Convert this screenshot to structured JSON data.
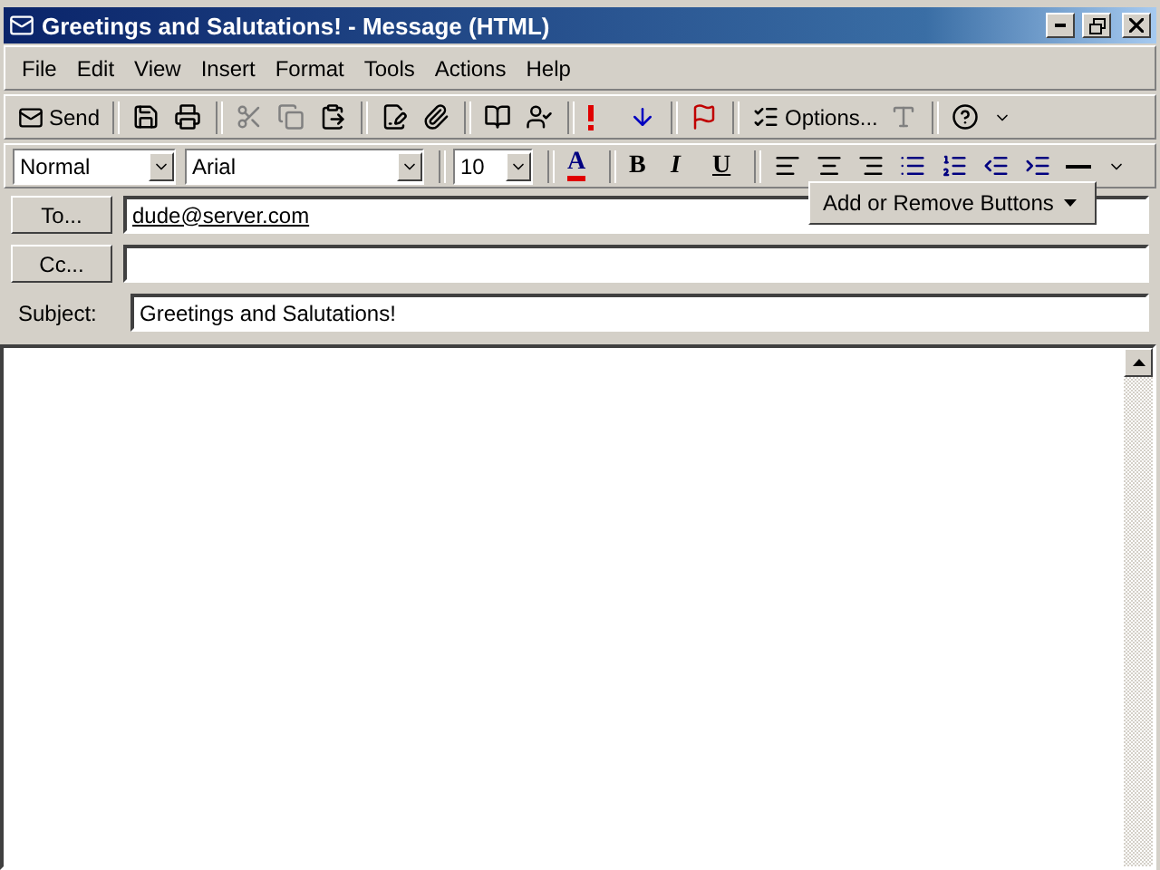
{
  "window": {
    "title": "Greetings and Salutations! - Message (HTML)"
  },
  "menu": [
    "File",
    "Edit",
    "View",
    "Insert",
    "Format",
    "Tools",
    "Actions",
    "Help"
  ],
  "standard_toolbar": [
    {
      "kind": "send",
      "label": "Send",
      "disabled": false
    },
    {
      "kind": "separator"
    },
    {
      "kind": "save",
      "disabled": false
    },
    {
      "kind": "print",
      "disabled": false
    },
    {
      "kind": "separator"
    },
    {
      "kind": "cut",
      "disabled": true
    },
    {
      "kind": "copy",
      "disabled": true
    },
    {
      "kind": "paste",
      "disabled": false
    },
    {
      "kind": "separator"
    },
    {
      "kind": "signature",
      "disabled": false
    },
    {
      "kind": "attach",
      "disabled": false
    },
    {
      "kind": "separator"
    },
    {
      "kind": "addressbook",
      "disabled": false
    },
    {
      "kind": "checknames",
      "disabled": false
    },
    {
      "kind": "separator"
    },
    {
      "kind": "high",
      "disabled": false
    },
    {
      "kind": "low",
      "disabled": false
    },
    {
      "kind": "separator"
    },
    {
      "kind": "flag",
      "disabled": false
    },
    {
      "kind": "separator"
    },
    {
      "kind": "options",
      "label": "Options...",
      "disabled": false
    },
    {
      "kind": "format",
      "disabled": true
    },
    {
      "kind": "separator"
    },
    {
      "kind": "help",
      "disabled": false
    },
    {
      "kind": "more"
    }
  ],
  "formatting_toolbar": {
    "style": "Normal",
    "font": "Arial",
    "size": "10",
    "buttons": [
      {
        "kind": "fontcolor",
        "label": "A"
      },
      {
        "kind": "separator"
      },
      {
        "kind": "bold",
        "label": "B"
      },
      {
        "kind": "italic",
        "label": "I"
      },
      {
        "kind": "underline",
        "label": "U"
      },
      {
        "kind": "separator"
      },
      {
        "kind": "alignleft"
      },
      {
        "kind": "aligncenter"
      },
      {
        "kind": "alignright"
      },
      {
        "kind": "bullets"
      },
      {
        "kind": "numbering"
      },
      {
        "kind": "outdent"
      },
      {
        "kind": "indent"
      },
      {
        "kind": "rule"
      },
      {
        "kind": "more"
      }
    ]
  },
  "popup": {
    "label": "Add or Remove Buttons"
  },
  "fields": [
    {
      "kind": "button",
      "label": "To...",
      "value": "dude@server.com"
    },
    {
      "kind": "button",
      "label": "Cc..."
    },
    {
      "kind": "text",
      "label": "Subject:",
      "value": "Greetings and Salutations!"
    }
  ]
}
